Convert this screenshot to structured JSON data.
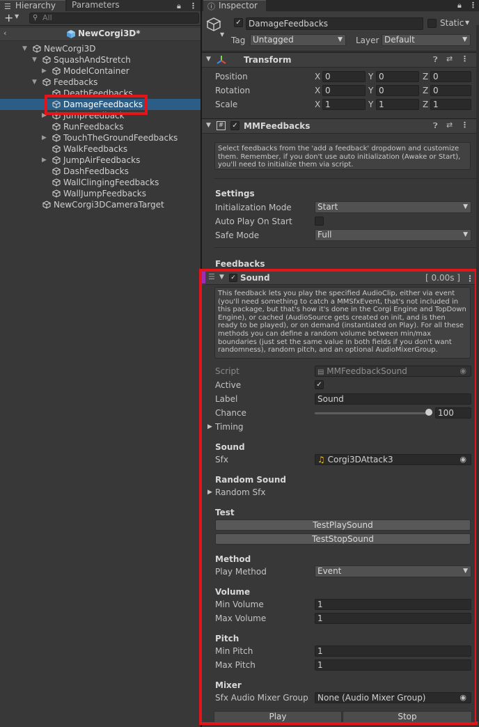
{
  "hierarchy": {
    "tab_label": "Hierarchy",
    "tab2_label": "Parameters",
    "add_label": "+",
    "search_placeholder": "All",
    "scene_name": "NewCorgi3D*",
    "items": [
      {
        "label": "NewCorgi3D",
        "depth": 0,
        "expand": "down"
      },
      {
        "label": "SquashAndStretch",
        "depth": 1,
        "expand": "down"
      },
      {
        "label": "ModelContainer",
        "depth": 2,
        "expand": "right"
      },
      {
        "label": "Feedbacks",
        "depth": 1,
        "expand": "down"
      },
      {
        "label": "DeathFeedbacks",
        "depth": 2,
        "expand": ""
      },
      {
        "label": "DamageFeedbacks",
        "depth": 2,
        "expand": "",
        "selected": true
      },
      {
        "label": "JumpFeedback",
        "depth": 2,
        "expand": "right"
      },
      {
        "label": "RunFeedbacks",
        "depth": 2,
        "expand": ""
      },
      {
        "label": "TouchTheGroundFeedbacks",
        "depth": 2,
        "expand": "right"
      },
      {
        "label": "WalkFeedbacks",
        "depth": 2,
        "expand": ""
      },
      {
        "label": "JumpAirFeedbacks",
        "depth": 2,
        "expand": "right"
      },
      {
        "label": "DashFeedbacks",
        "depth": 2,
        "expand": ""
      },
      {
        "label": "WallClingingFeedbacks",
        "depth": 2,
        "expand": ""
      },
      {
        "label": "WallJumpFeedbacks",
        "depth": 2,
        "expand": ""
      },
      {
        "label": "NewCorgi3DCameraTarget",
        "depth": 1,
        "expand": ""
      }
    ]
  },
  "inspector": {
    "tab_label": "Inspector",
    "object_name": "DamageFeedbacks",
    "static_label": "Static",
    "tag_label": "Tag",
    "tag_value": "Untagged",
    "layer_label": "Layer",
    "layer_value": "Default",
    "transform": {
      "title": "Transform",
      "rows": [
        {
          "label": "Position",
          "x": "0",
          "y": "0",
          "z": "0"
        },
        {
          "label": "Rotation",
          "x": "0",
          "y": "0",
          "z": "0"
        },
        {
          "label": "Scale",
          "x": "1",
          "y": "1",
          "z": "1"
        }
      ]
    },
    "mmfeedbacks": {
      "title": "MMFeedbacks",
      "help": "Select feedbacks from the 'add a feedback' dropdown and customize them. Remember, if you don't use auto initialization (Awake or Start), you'll need to initialize them via script.",
      "settings_header": "Settings",
      "init_mode_label": "Initialization Mode",
      "init_mode_value": "Start",
      "auto_play_label": "Auto Play On Start",
      "safe_mode_label": "Safe Mode",
      "safe_mode_value": "Full",
      "feedbacks_header": "Feedbacks"
    },
    "sound": {
      "title": "Sound",
      "duration": "[ 0.00s ]",
      "help": "This feedback lets you play the specified AudioClip, either via event (you'll need something to catch a MMSfxEvent, that's not included in this package, but that's how it's done in the Corgi Engine and TopDown Engine), or cached (AudioSource gets created on init, and is then ready to be played), or on demand (instantiated on Play). For all these methods you can define a random volume between min/max boundaries (just set the same value in both fields if you don't want randomness), random pitch, and an optional AudioMixerGroup.",
      "script_label": "Script",
      "script_value": "MMFeedbackSound",
      "active_label": "Active",
      "label_label": "Label",
      "label_value": "Sound",
      "chance_label": "Chance",
      "chance_value": "100",
      "timing_label": "Timing",
      "sound_header": "Sound",
      "sfx_label": "Sfx",
      "sfx_value": "Corgi3DAttack3",
      "random_sound_header": "Random Sound",
      "random_sfx_label": "Random Sfx",
      "test_header": "Test",
      "test_play_button": "TestPlaySound",
      "test_stop_button": "TestStopSound",
      "method_header": "Method",
      "play_method_label": "Play Method",
      "play_method_value": "Event",
      "volume_header": "Volume",
      "min_volume_label": "Min Volume",
      "min_volume_value": "1",
      "max_volume_label": "Max Volume",
      "max_volume_value": "1",
      "pitch_header": "Pitch",
      "min_pitch_label": "Min Pitch",
      "min_pitch_value": "1",
      "max_pitch_label": "Max Pitch",
      "max_pitch_value": "1",
      "mixer_header": "Mixer",
      "mixer_label": "Sfx Audio Mixer Group",
      "mixer_value": "None (Audio Mixer Group)",
      "play_button": "Play",
      "stop_button": "Stop"
    }
  },
  "colors": {
    "selection": "#2c5d87",
    "highlight_red": "#e3141a",
    "accent_purple": "#9b2fb5"
  }
}
